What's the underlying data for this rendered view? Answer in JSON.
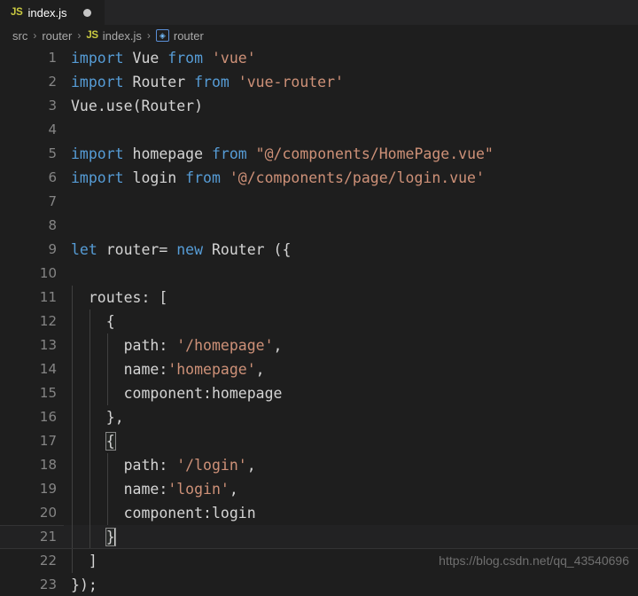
{
  "tab": {
    "file_icon": "js-file-icon",
    "file_icon_label": "JS",
    "label": "index.js",
    "dirty_indicator": "unsaved-dot"
  },
  "breadcrumb": {
    "items": [
      "src",
      "router",
      "index.js",
      "router"
    ],
    "separator": "›",
    "file_icon_label": "JS",
    "symbol_icon": "variable-symbol-icon",
    "symbol_glyph": "◈"
  },
  "editor": {
    "language": "javascript",
    "active_line": 21,
    "lines": [
      {
        "n": "1",
        "text": "import Vue from 'vue'"
      },
      {
        "n": "2",
        "text": "import Router from 'vue-router'"
      },
      {
        "n": "3",
        "text": "Vue.use(Router)"
      },
      {
        "n": "4",
        "text": ""
      },
      {
        "n": "5",
        "text": "import homepage from \"@/components/HomePage.vue\""
      },
      {
        "n": "6",
        "text": "import login from '@/components/page/login.vue'"
      },
      {
        "n": "7",
        "text": ""
      },
      {
        "n": "8",
        "text": ""
      },
      {
        "n": "9",
        "text": "let router= new Router ({"
      },
      {
        "n": "10",
        "text": ""
      },
      {
        "n": "11",
        "text": "  routes: ["
      },
      {
        "n": "12",
        "text": "    {"
      },
      {
        "n": "13",
        "text": "      path: '/homepage',"
      },
      {
        "n": "14",
        "text": "      name:'homepage',"
      },
      {
        "n": "15",
        "text": "      component:homepage"
      },
      {
        "n": "16",
        "text": "    },"
      },
      {
        "n": "17",
        "text": "    {"
      },
      {
        "n": "18",
        "text": "      path: '/login',"
      },
      {
        "n": "19",
        "text": "      name:'login',"
      },
      {
        "n": "20",
        "text": "      component:login"
      },
      {
        "n": "21",
        "text": "    }"
      },
      {
        "n": "22",
        "text": "  ]"
      },
      {
        "n": "23",
        "text": "});"
      }
    ]
  },
  "watermark": {
    "text": "https://blog.csdn.net/qq_43540696"
  },
  "colors": {
    "editor_background": "#1e1e1e",
    "tabbar_background": "#252526",
    "keyword": "#569cd6",
    "string": "#ce9178",
    "identifier": "#d4d4d4",
    "line_number": "#858585",
    "breadcrumb_text": "#a9a9a9",
    "js_badge": "#cbcb41",
    "active_line_background": "#222223"
  }
}
